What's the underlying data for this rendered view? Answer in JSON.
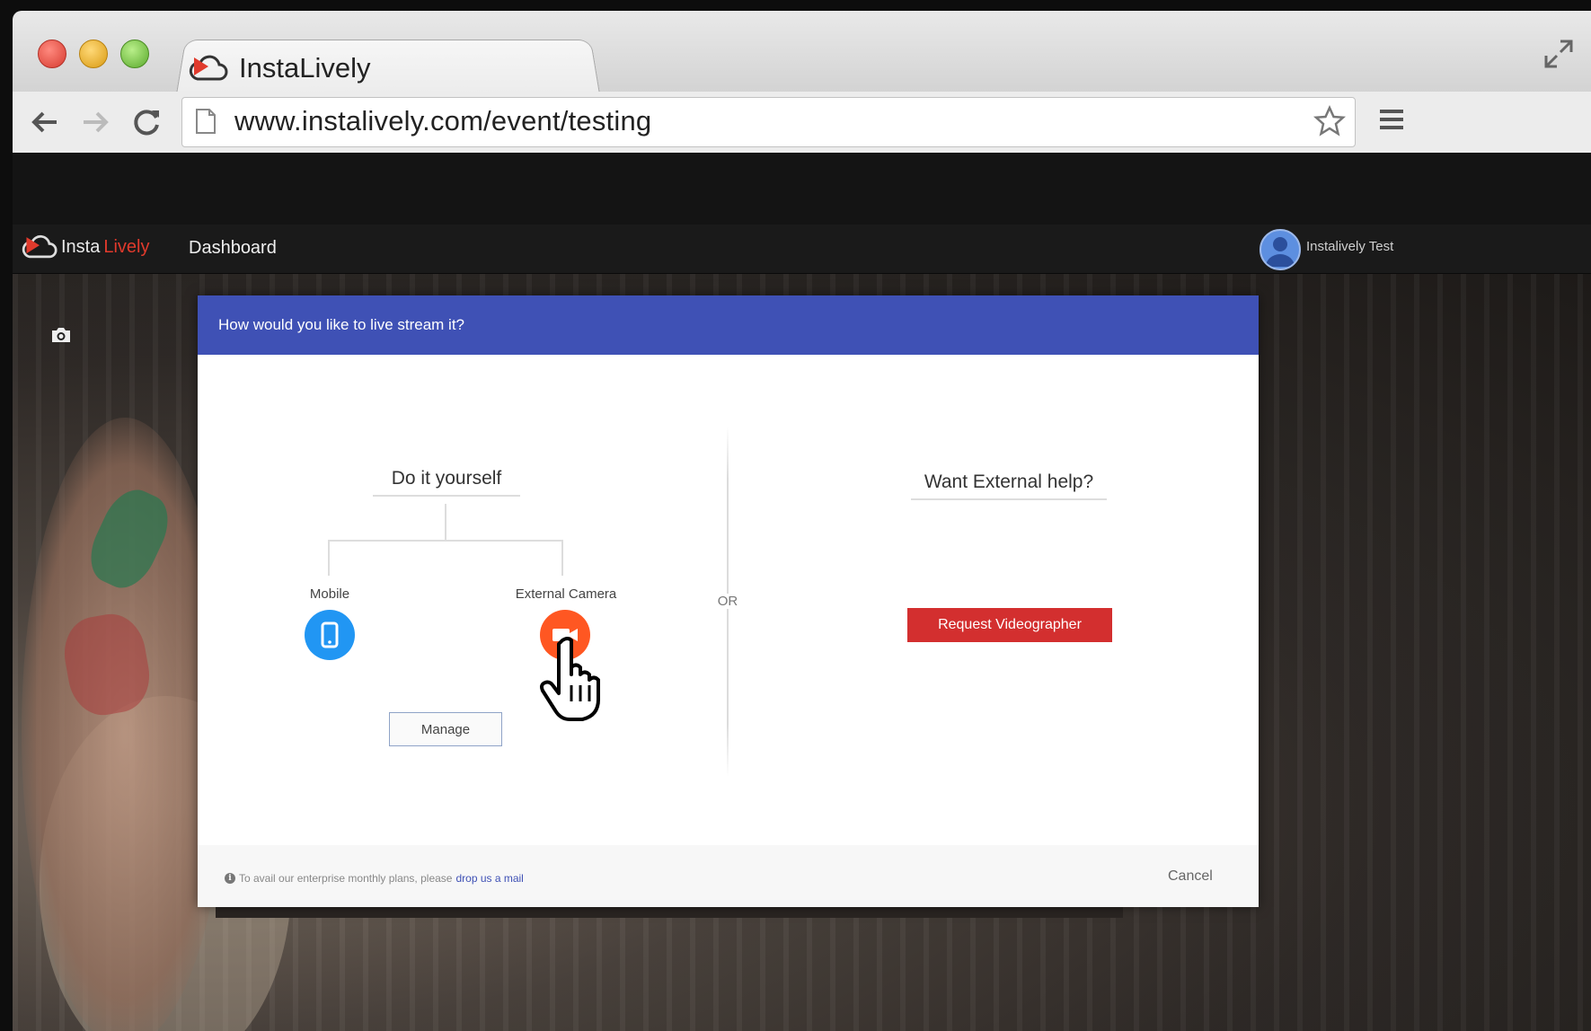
{
  "browser": {
    "tab_title": "InstaLively",
    "url": "www.instalively.com/event/testing"
  },
  "app_nav": {
    "brand_part1": "Insta",
    "brand_part2": "Lively",
    "dashboard_label": "Dashboard",
    "username": "Instalively Test"
  },
  "modal": {
    "title": "How would you like to live stream it?",
    "diy_title": "Do it yourself",
    "mobile_label": "Mobile",
    "external_camera_label": "External Camera",
    "manage_label": "Manage",
    "or_label": "OR",
    "help_title": "Want External help?",
    "request_label": "Request Videographer",
    "footer_text": "To avail our enterprise monthly plans, please",
    "footer_link": "drop us a mail",
    "cancel_label": "Cancel"
  },
  "colors": {
    "header_blue": "#3f51b5",
    "mobile_blue": "#2196f3",
    "camera_orange": "#ff5722",
    "request_red": "#d32f2f",
    "brand_red": "#e03a2c"
  },
  "icons": [
    "close-dot",
    "minimize-dot",
    "maximize-dot",
    "instalively-logo-icon",
    "fullscreen-icon",
    "back-arrow-icon",
    "forward-arrow-icon",
    "reload-icon",
    "page-icon",
    "star-icon",
    "hamburger-menu-icon",
    "camera-icon",
    "avatar-icon",
    "phone-icon",
    "video-camera-icon",
    "hand-pointer-icon",
    "info-icon"
  ]
}
